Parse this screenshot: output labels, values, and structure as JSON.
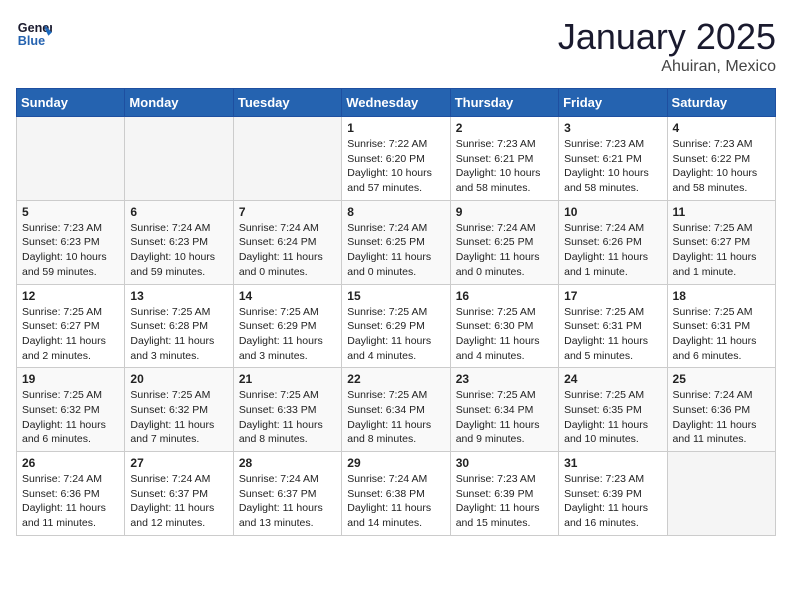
{
  "header": {
    "logo_line1": "General",
    "logo_line2": "Blue",
    "month": "January 2025",
    "location": "Ahuiran, Mexico"
  },
  "weekdays": [
    "Sunday",
    "Monday",
    "Tuesday",
    "Wednesday",
    "Thursday",
    "Friday",
    "Saturday"
  ],
  "weeks": [
    [
      {
        "day": "",
        "info": ""
      },
      {
        "day": "",
        "info": ""
      },
      {
        "day": "",
        "info": ""
      },
      {
        "day": "1",
        "info": "Sunrise: 7:22 AM\nSunset: 6:20 PM\nDaylight: 10 hours and 57 minutes."
      },
      {
        "day": "2",
        "info": "Sunrise: 7:23 AM\nSunset: 6:21 PM\nDaylight: 10 hours and 58 minutes."
      },
      {
        "day": "3",
        "info": "Sunrise: 7:23 AM\nSunset: 6:21 PM\nDaylight: 10 hours and 58 minutes."
      },
      {
        "day": "4",
        "info": "Sunrise: 7:23 AM\nSunset: 6:22 PM\nDaylight: 10 hours and 58 minutes."
      }
    ],
    [
      {
        "day": "5",
        "info": "Sunrise: 7:23 AM\nSunset: 6:23 PM\nDaylight: 10 hours and 59 minutes."
      },
      {
        "day": "6",
        "info": "Sunrise: 7:24 AM\nSunset: 6:23 PM\nDaylight: 10 hours and 59 minutes."
      },
      {
        "day": "7",
        "info": "Sunrise: 7:24 AM\nSunset: 6:24 PM\nDaylight: 11 hours and 0 minutes."
      },
      {
        "day": "8",
        "info": "Sunrise: 7:24 AM\nSunset: 6:25 PM\nDaylight: 11 hours and 0 minutes."
      },
      {
        "day": "9",
        "info": "Sunrise: 7:24 AM\nSunset: 6:25 PM\nDaylight: 11 hours and 0 minutes."
      },
      {
        "day": "10",
        "info": "Sunrise: 7:24 AM\nSunset: 6:26 PM\nDaylight: 11 hours and 1 minute."
      },
      {
        "day": "11",
        "info": "Sunrise: 7:25 AM\nSunset: 6:27 PM\nDaylight: 11 hours and 1 minute."
      }
    ],
    [
      {
        "day": "12",
        "info": "Sunrise: 7:25 AM\nSunset: 6:27 PM\nDaylight: 11 hours and 2 minutes."
      },
      {
        "day": "13",
        "info": "Sunrise: 7:25 AM\nSunset: 6:28 PM\nDaylight: 11 hours and 3 minutes."
      },
      {
        "day": "14",
        "info": "Sunrise: 7:25 AM\nSunset: 6:29 PM\nDaylight: 11 hours and 3 minutes."
      },
      {
        "day": "15",
        "info": "Sunrise: 7:25 AM\nSunset: 6:29 PM\nDaylight: 11 hours and 4 minutes."
      },
      {
        "day": "16",
        "info": "Sunrise: 7:25 AM\nSunset: 6:30 PM\nDaylight: 11 hours and 4 minutes."
      },
      {
        "day": "17",
        "info": "Sunrise: 7:25 AM\nSunset: 6:31 PM\nDaylight: 11 hours and 5 minutes."
      },
      {
        "day": "18",
        "info": "Sunrise: 7:25 AM\nSunset: 6:31 PM\nDaylight: 11 hours and 6 minutes."
      }
    ],
    [
      {
        "day": "19",
        "info": "Sunrise: 7:25 AM\nSunset: 6:32 PM\nDaylight: 11 hours and 6 minutes."
      },
      {
        "day": "20",
        "info": "Sunrise: 7:25 AM\nSunset: 6:32 PM\nDaylight: 11 hours and 7 minutes."
      },
      {
        "day": "21",
        "info": "Sunrise: 7:25 AM\nSunset: 6:33 PM\nDaylight: 11 hours and 8 minutes."
      },
      {
        "day": "22",
        "info": "Sunrise: 7:25 AM\nSunset: 6:34 PM\nDaylight: 11 hours and 8 minutes."
      },
      {
        "day": "23",
        "info": "Sunrise: 7:25 AM\nSunset: 6:34 PM\nDaylight: 11 hours and 9 minutes."
      },
      {
        "day": "24",
        "info": "Sunrise: 7:25 AM\nSunset: 6:35 PM\nDaylight: 11 hours and 10 minutes."
      },
      {
        "day": "25",
        "info": "Sunrise: 7:24 AM\nSunset: 6:36 PM\nDaylight: 11 hours and 11 minutes."
      }
    ],
    [
      {
        "day": "26",
        "info": "Sunrise: 7:24 AM\nSunset: 6:36 PM\nDaylight: 11 hours and 11 minutes."
      },
      {
        "day": "27",
        "info": "Sunrise: 7:24 AM\nSunset: 6:37 PM\nDaylight: 11 hours and 12 minutes."
      },
      {
        "day": "28",
        "info": "Sunrise: 7:24 AM\nSunset: 6:37 PM\nDaylight: 11 hours and 13 minutes."
      },
      {
        "day": "29",
        "info": "Sunrise: 7:24 AM\nSunset: 6:38 PM\nDaylight: 11 hours and 14 minutes."
      },
      {
        "day": "30",
        "info": "Sunrise: 7:23 AM\nSunset: 6:39 PM\nDaylight: 11 hours and 15 minutes."
      },
      {
        "day": "31",
        "info": "Sunrise: 7:23 AM\nSunset: 6:39 PM\nDaylight: 11 hours and 16 minutes."
      },
      {
        "day": "",
        "info": ""
      }
    ]
  ]
}
